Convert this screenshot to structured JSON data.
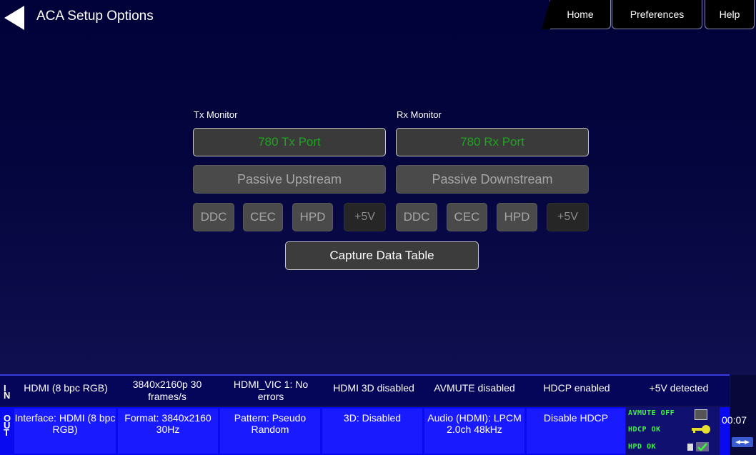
{
  "header": {
    "title": "ACA Setup Options",
    "tabs": [
      "Home",
      "Preferences",
      "Help"
    ]
  },
  "tx": {
    "label": "Tx Monitor",
    "port": "780 Tx Port",
    "passive": "Passive Upstream",
    "signals": [
      "DDC",
      "CEC",
      "HPD",
      "+5V"
    ]
  },
  "rx": {
    "label": "Rx Monitor",
    "port": "780 Rx Port",
    "passive": "Passive Downstream",
    "signals": [
      "DDC",
      "CEC",
      "HPD",
      "+5V"
    ]
  },
  "capture_label": "Capture Data Table",
  "in_bar": {
    "letters": [
      "I",
      "N"
    ],
    "items": [
      "HDMI (8 bpc RGB)",
      "3840x2160p 30 frames/s",
      "HDMI_VIC 1: No errors",
      "HDMI 3D disabled",
      "AVMUTE disabled",
      "HDCP enabled",
      "+5V detected"
    ]
  },
  "out_bar": {
    "letters": [
      "O",
      "U",
      "T"
    ],
    "items": [
      "Interface: HDMI (8 bpc RGB)",
      "Format: 3840x2160 30Hz",
      "Pattern: Pseudo Random",
      "3D: Disabled",
      "Audio (HDMI): LPCM 2.0ch 48kHz",
      "Disable HDCP"
    ]
  },
  "status": {
    "avmute": "AVMUTE OFF",
    "hdcp": "HDCP OK",
    "hpd": "HPD OK",
    "time": "00:07",
    "colors": {
      "ok": "#3cf53c",
      "bar": "#1a1aff"
    }
  }
}
